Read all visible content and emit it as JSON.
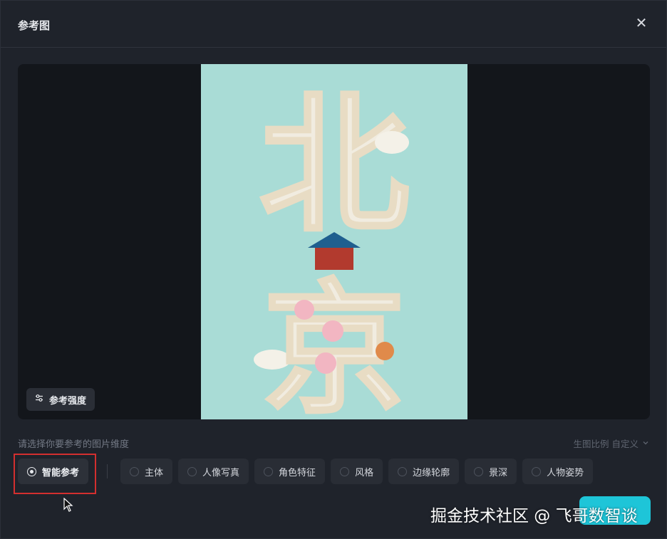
{
  "dialog": {
    "title": "参考图",
    "close_icon": "close-icon"
  },
  "preview": {
    "strength_label": "参考强度",
    "strength_icon": "sliders-icon",
    "image_text_top": "北",
    "image_text_bottom": "京"
  },
  "dimensions": {
    "hint": "请选择你要参考的图片维度",
    "ratio_label": "生图比例 自定义",
    "selected_option": "智能参考",
    "options": [
      "主体",
      "人像写真",
      "角色特征",
      "风格",
      "边缘轮廓",
      "景深",
      "人物姿势"
    ]
  },
  "watermark": "掘金技术社区 @ 飞哥数智谈",
  "colors": {
    "accent": "#1ec5d8",
    "highlight_box": "#d32f2f",
    "image_background": "#a9dcd6"
  }
}
